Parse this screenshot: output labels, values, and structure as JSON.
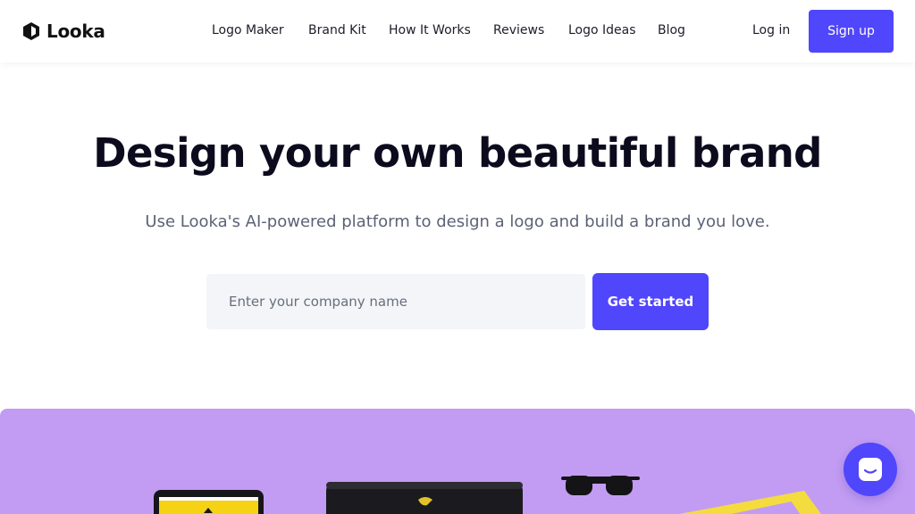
{
  "brand": {
    "name": "Looka",
    "accent": "#5046fc",
    "showcase_bg": "#c29cf2"
  },
  "nav": {
    "items": [
      {
        "label": "Logo Maker"
      },
      {
        "label": "Brand Kit"
      },
      {
        "label": "How It Works"
      },
      {
        "label": "Reviews"
      },
      {
        "label": "Logo Ideas"
      },
      {
        "label": "Blog"
      }
    ],
    "login_label": "Log in",
    "signup_label": "Sign up"
  },
  "hero": {
    "title": "Design your own beautiful brand",
    "subtitle": "Use Looka's AI-powered platform to design a logo and build a brand you love.",
    "input_placeholder": "Enter your company name",
    "cta_label": "Get started"
  },
  "icons": {
    "logo": "looka-logo-icon",
    "chat": "chat-smile-icon"
  }
}
